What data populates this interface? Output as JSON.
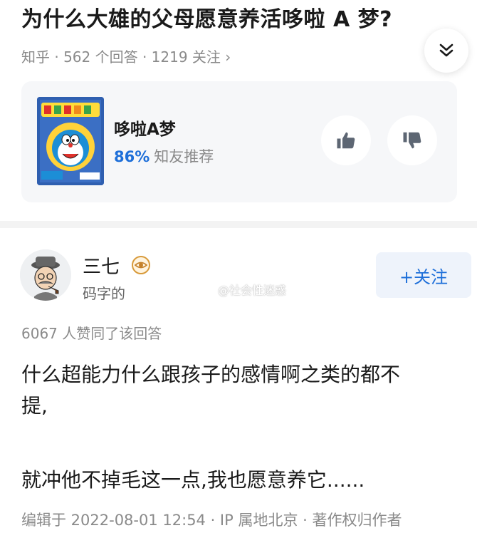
{
  "question": {
    "title": "为什么大雄的父母愿意养活哆啦 A 梦?",
    "meta": "知乎 · 562 个回答 · 1219 关注 ›"
  },
  "card": {
    "title": "哆啦A梦",
    "percent": "86%",
    "recommend": "知友推荐"
  },
  "author": {
    "name": "三七",
    "bio": "码字的",
    "follow_label": "+关注"
  },
  "watermark": "@社会性迷惑",
  "answer": {
    "likes": "6067 人赞同了该回答",
    "paragraphs": [
      "什么超能力什么跟孩子的感情啊之类的都不",
      "提,",
      "就冲他不掉毛这一点,我也愿意养它......"
    ],
    "edit_meta": "编辑于 2022-08-01 12:54 · IP 属地北京 · 著作权归作者"
  },
  "icons": {
    "collapse": "chevron-double-down-icon",
    "upvote": "thumbs-up-icon",
    "downvote": "thumbs-down-icon",
    "badge": "eye-badge-icon"
  },
  "colors": {
    "accent": "#1e6fd9",
    "muted": "#8a8a8a",
    "card_bg": "#f6f7f9",
    "follow_bg": "#eef3fb"
  }
}
